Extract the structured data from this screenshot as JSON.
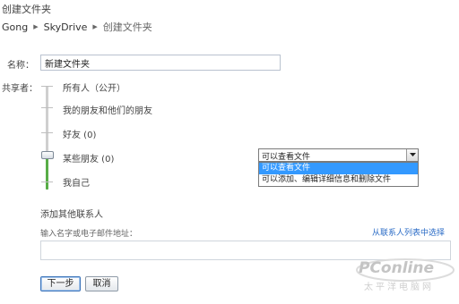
{
  "page": {
    "title": "创建文件夹"
  },
  "breadcrumb": {
    "items": [
      "Gong",
      "SkyDrive",
      "创建文件夹"
    ]
  },
  "form": {
    "name_label": "名称：",
    "name_value": "新建文件夹",
    "sharer_label": "共享者："
  },
  "share_levels": {
    "items": [
      {
        "label": "所有人（公开）"
      },
      {
        "label": "我的朋友和他们的朋友"
      },
      {
        "label": "好友 (0)"
      },
      {
        "label": "某些朋友 (0)"
      },
      {
        "label": "我自己"
      }
    ],
    "selected": "某些朋友 (0)"
  },
  "permission_dropdown": {
    "value": "可以查看文件",
    "options": [
      "可以查看文件",
      "可以添加、编辑详细信息和删除文件"
    ],
    "highlighted": "可以查看文件"
  },
  "add_contacts": {
    "title": "添加其他联系人",
    "input_label": "输入名字或电子邮件地址：",
    "link": "从联系人列表中选择"
  },
  "buttons": {
    "next": "下一步",
    "cancel": "取消"
  },
  "watermark": {
    "text": "PConline",
    "subtext": "太平洋电脑网"
  },
  "colors": {
    "accent": "#58ad47",
    "selection": "#3399ff",
    "link": "#2a6bc6"
  }
}
